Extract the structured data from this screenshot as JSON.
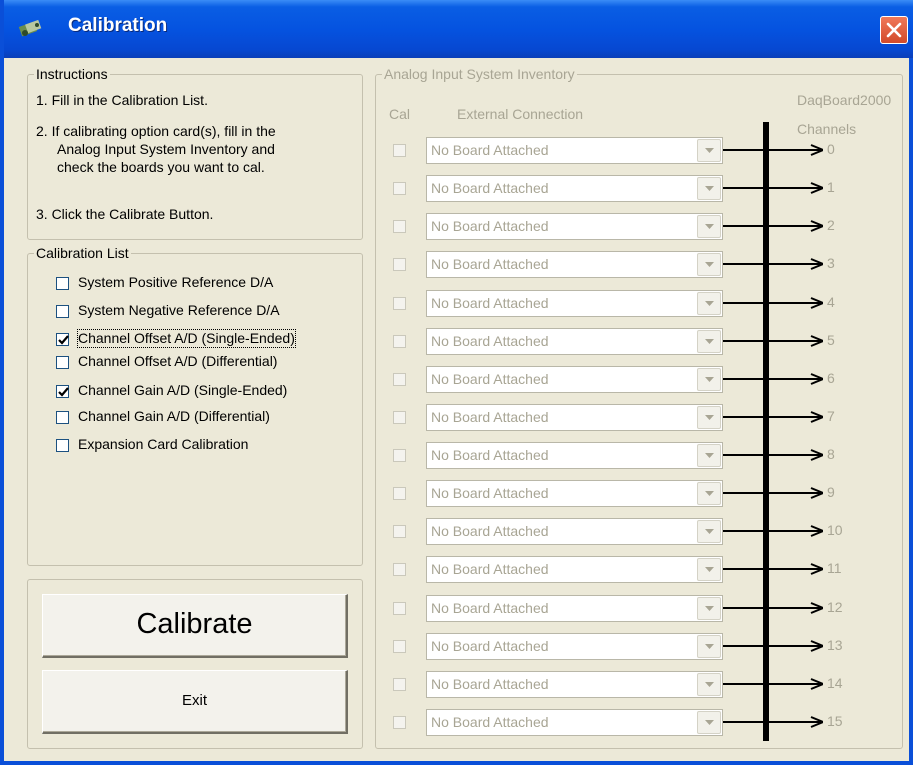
{
  "window": {
    "title": "Calibration"
  },
  "instructions": {
    "title": "Instructions",
    "step1": "1. Fill in the Calibration List.",
    "step2_line1": "2. If calibrating option card(s), fill in the",
    "step2_line2": "Analog Input System Inventory and",
    "step2_line3": "check the boards you want to cal.",
    "step3": "3. Click the Calibrate Button."
  },
  "calibration_list": {
    "title": "Calibration List",
    "items": [
      {
        "label": "System Positive Reference D/A",
        "checked": false
      },
      {
        "label": "System Negative Reference D/A",
        "checked": false
      },
      {
        "label": "Channel Offset A/D (Single-Ended)",
        "checked": true
      },
      {
        "label": "Channel Offset A/D (Differential)",
        "checked": false
      },
      {
        "label": "Channel Gain A/D (Single-Ended)",
        "checked": true
      },
      {
        "label": "Channel Gain A/D (Differential)",
        "checked": false
      },
      {
        "label": "Expansion Card Calibration",
        "checked": false
      }
    ]
  },
  "buttons": {
    "calibrate": "Calibrate",
    "exit": "Exit"
  },
  "inventory": {
    "title": "Analog Input System Inventory",
    "col_cal": "Cal",
    "col_external": "External Connection",
    "board_name": "DaqBoard2000",
    "channels_label": "Channels",
    "rows": [
      {
        "value": "No Board Attached",
        "channel": "0"
      },
      {
        "value": "No Board Attached",
        "channel": "1"
      },
      {
        "value": "No Board Attached",
        "channel": "2"
      },
      {
        "value": "No Board Attached",
        "channel": "3"
      },
      {
        "value": "No Board Attached",
        "channel": "4"
      },
      {
        "value": "No Board Attached",
        "channel": "5"
      },
      {
        "value": "No Board Attached",
        "channel": "6"
      },
      {
        "value": "No Board Attached",
        "channel": "7"
      },
      {
        "value": "No Board Attached",
        "channel": "8"
      },
      {
        "value": "No Board Attached",
        "channel": "9"
      },
      {
        "value": "No Board Attached",
        "channel": "10"
      },
      {
        "value": "No Board Attached",
        "channel": "11"
      },
      {
        "value": "No Board Attached",
        "channel": "12"
      },
      {
        "value": "No Board Attached",
        "channel": "13"
      },
      {
        "value": "No Board Attached",
        "channel": "14"
      },
      {
        "value": "No Board Attached",
        "channel": "15"
      }
    ]
  }
}
